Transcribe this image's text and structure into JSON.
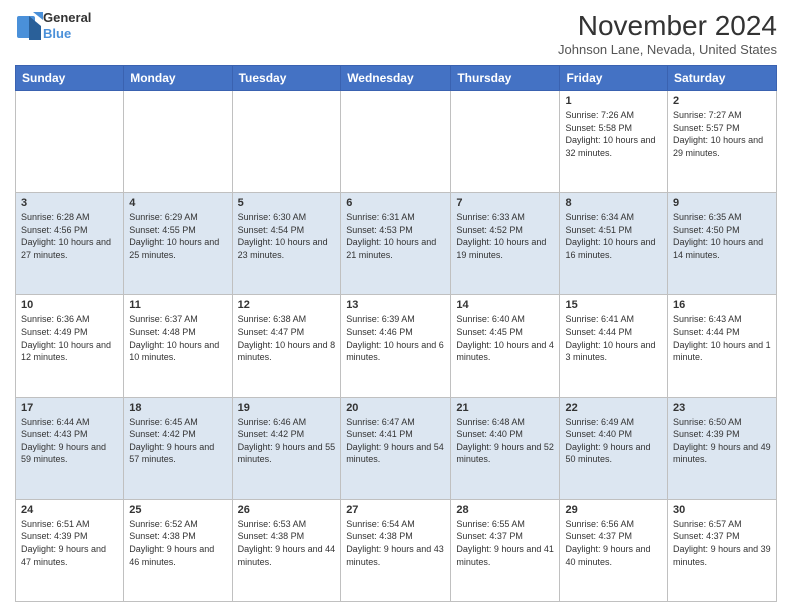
{
  "logo": {
    "general": "General",
    "blue": "Blue"
  },
  "header": {
    "title": "November 2024",
    "location": "Johnson Lane, Nevada, United States"
  },
  "calendar": {
    "weekdays": [
      "Sunday",
      "Monday",
      "Tuesday",
      "Wednesday",
      "Thursday",
      "Friday",
      "Saturday"
    ],
    "weeks": [
      [
        {
          "day": "",
          "info": ""
        },
        {
          "day": "",
          "info": ""
        },
        {
          "day": "",
          "info": ""
        },
        {
          "day": "",
          "info": ""
        },
        {
          "day": "",
          "info": ""
        },
        {
          "day": "1",
          "info": "Sunrise: 7:26 AM\nSunset: 5:58 PM\nDaylight: 10 hours and 32 minutes."
        },
        {
          "day": "2",
          "info": "Sunrise: 7:27 AM\nSunset: 5:57 PM\nDaylight: 10 hours and 29 minutes."
        }
      ],
      [
        {
          "day": "3",
          "info": "Sunrise: 6:28 AM\nSunset: 4:56 PM\nDaylight: 10 hours and 27 minutes."
        },
        {
          "day": "4",
          "info": "Sunrise: 6:29 AM\nSunset: 4:55 PM\nDaylight: 10 hours and 25 minutes."
        },
        {
          "day": "5",
          "info": "Sunrise: 6:30 AM\nSunset: 4:54 PM\nDaylight: 10 hours and 23 minutes."
        },
        {
          "day": "6",
          "info": "Sunrise: 6:31 AM\nSunset: 4:53 PM\nDaylight: 10 hours and 21 minutes."
        },
        {
          "day": "7",
          "info": "Sunrise: 6:33 AM\nSunset: 4:52 PM\nDaylight: 10 hours and 19 minutes."
        },
        {
          "day": "8",
          "info": "Sunrise: 6:34 AM\nSunset: 4:51 PM\nDaylight: 10 hours and 16 minutes."
        },
        {
          "day": "9",
          "info": "Sunrise: 6:35 AM\nSunset: 4:50 PM\nDaylight: 10 hours and 14 minutes."
        }
      ],
      [
        {
          "day": "10",
          "info": "Sunrise: 6:36 AM\nSunset: 4:49 PM\nDaylight: 10 hours and 12 minutes."
        },
        {
          "day": "11",
          "info": "Sunrise: 6:37 AM\nSunset: 4:48 PM\nDaylight: 10 hours and 10 minutes."
        },
        {
          "day": "12",
          "info": "Sunrise: 6:38 AM\nSunset: 4:47 PM\nDaylight: 10 hours and 8 minutes."
        },
        {
          "day": "13",
          "info": "Sunrise: 6:39 AM\nSunset: 4:46 PM\nDaylight: 10 hours and 6 minutes."
        },
        {
          "day": "14",
          "info": "Sunrise: 6:40 AM\nSunset: 4:45 PM\nDaylight: 10 hours and 4 minutes."
        },
        {
          "day": "15",
          "info": "Sunrise: 6:41 AM\nSunset: 4:44 PM\nDaylight: 10 hours and 3 minutes."
        },
        {
          "day": "16",
          "info": "Sunrise: 6:43 AM\nSunset: 4:44 PM\nDaylight: 10 hours and 1 minute."
        }
      ],
      [
        {
          "day": "17",
          "info": "Sunrise: 6:44 AM\nSunset: 4:43 PM\nDaylight: 9 hours and 59 minutes."
        },
        {
          "day": "18",
          "info": "Sunrise: 6:45 AM\nSunset: 4:42 PM\nDaylight: 9 hours and 57 minutes."
        },
        {
          "day": "19",
          "info": "Sunrise: 6:46 AM\nSunset: 4:42 PM\nDaylight: 9 hours and 55 minutes."
        },
        {
          "day": "20",
          "info": "Sunrise: 6:47 AM\nSunset: 4:41 PM\nDaylight: 9 hours and 54 minutes."
        },
        {
          "day": "21",
          "info": "Sunrise: 6:48 AM\nSunset: 4:40 PM\nDaylight: 9 hours and 52 minutes."
        },
        {
          "day": "22",
          "info": "Sunrise: 6:49 AM\nSunset: 4:40 PM\nDaylight: 9 hours and 50 minutes."
        },
        {
          "day": "23",
          "info": "Sunrise: 6:50 AM\nSunset: 4:39 PM\nDaylight: 9 hours and 49 minutes."
        }
      ],
      [
        {
          "day": "24",
          "info": "Sunrise: 6:51 AM\nSunset: 4:39 PM\nDaylight: 9 hours and 47 minutes."
        },
        {
          "day": "25",
          "info": "Sunrise: 6:52 AM\nSunset: 4:38 PM\nDaylight: 9 hours and 46 minutes."
        },
        {
          "day": "26",
          "info": "Sunrise: 6:53 AM\nSunset: 4:38 PM\nDaylight: 9 hours and 44 minutes."
        },
        {
          "day": "27",
          "info": "Sunrise: 6:54 AM\nSunset: 4:38 PM\nDaylight: 9 hours and 43 minutes."
        },
        {
          "day": "28",
          "info": "Sunrise: 6:55 AM\nSunset: 4:37 PM\nDaylight: 9 hours and 41 minutes."
        },
        {
          "day": "29",
          "info": "Sunrise: 6:56 AM\nSunset: 4:37 PM\nDaylight: 9 hours and 40 minutes."
        },
        {
          "day": "30",
          "info": "Sunrise: 6:57 AM\nSunset: 4:37 PM\nDaylight: 9 hours and 39 minutes."
        }
      ]
    ]
  }
}
